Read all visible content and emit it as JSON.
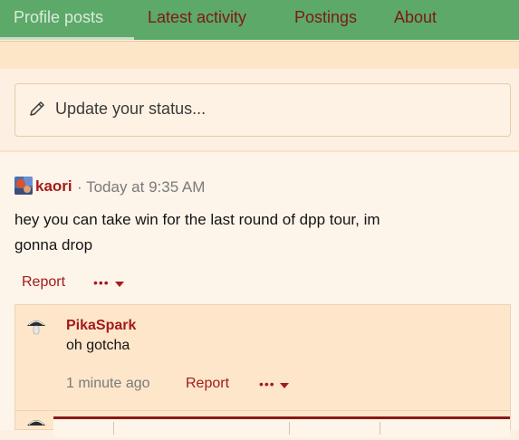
{
  "tabs": [
    {
      "label": "Profile posts",
      "active": true
    },
    {
      "label": "Latest activity"
    },
    {
      "label": "Postings"
    },
    {
      "label": "About"
    }
  ],
  "status_update": {
    "placeholder": "Update your status...",
    "icon": "pencil-icon"
  },
  "post": {
    "author": "kaori",
    "time": "· Today at 9:35 AM",
    "body_line1": "hey you can take win for the last round of dpp tour, im",
    "body_line2": "gonna drop",
    "report_label": "Report",
    "more_label": "•••"
  },
  "comment": {
    "author": "PikaSpark",
    "text": "oh gotcha",
    "time": "1 minute ago",
    "report_label": "Report",
    "more_label": "•••"
  },
  "colors": {
    "tab_bar": "#5ca96a",
    "accent_link": "#a31b1b",
    "page_bg": "#fdf0e2"
  }
}
